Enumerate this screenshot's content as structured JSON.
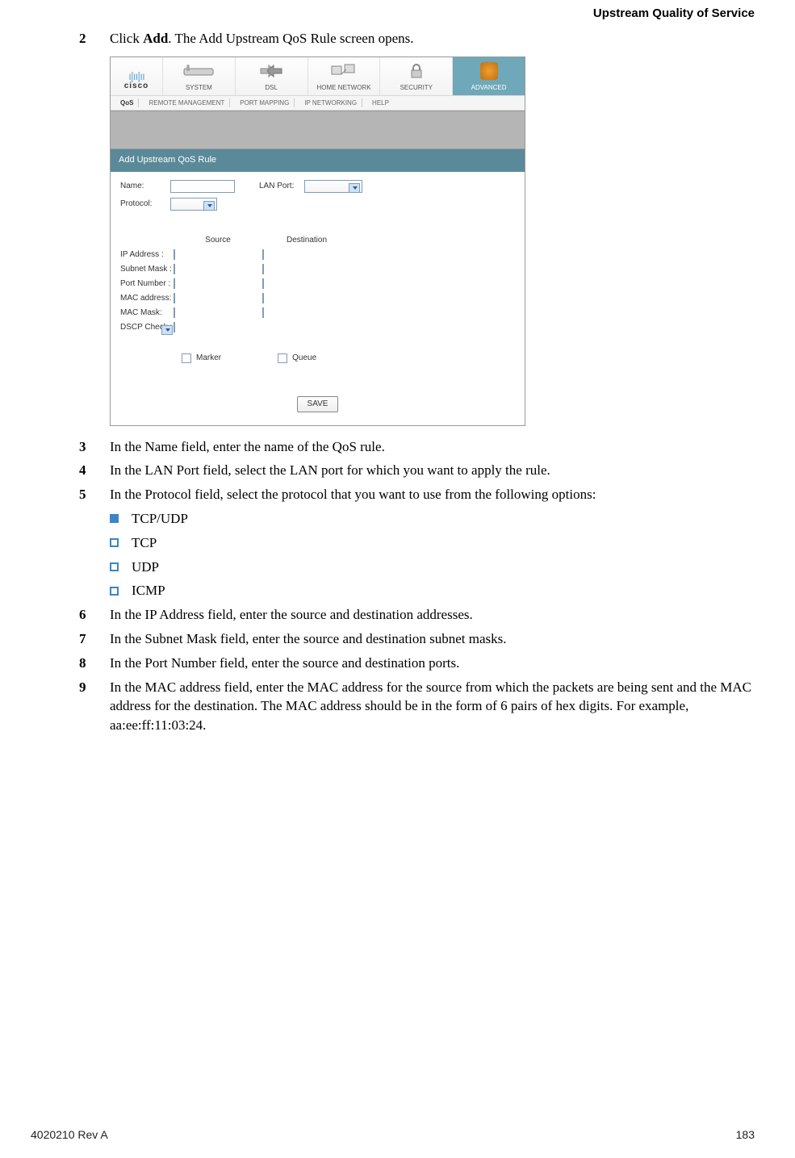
{
  "header": {
    "section_title": "Upstream Quality of Service"
  },
  "steps": {
    "s2": {
      "num": "2",
      "text_pre": "Click ",
      "bold": "Add",
      "text_post": ". The Add Upstream QoS Rule screen opens."
    },
    "s3": {
      "num": "3",
      "text": "In the Name field, enter the name of the QoS rule."
    },
    "s4": {
      "num": "4",
      "text": "In the LAN Port field, select the LAN port for which you want to apply the rule."
    },
    "s5": {
      "num": "5",
      "text": "In the Protocol field, select the protocol that you want to use from the following options:"
    },
    "s6": {
      "num": "6",
      "text": "In the IP Address field, enter the source and destination addresses."
    },
    "s7": {
      "num": "7",
      "text": "In the Subnet Mask field, enter the source and destination subnet masks."
    },
    "s8": {
      "num": "8",
      "text": "In the Port Number field, enter the source and destination ports."
    },
    "s9": {
      "num": "9",
      "text": "In the MAC address field, enter the MAC address for the source from which the packets are being sent and the MAC address for the destination. The MAC address should be in the form of 6 pairs of hex digits. For example, aa:ee:ff:11:03:24."
    }
  },
  "protocols": {
    "p1": "TCP/UDP",
    "p2": "TCP",
    "p3": "UDP",
    "p4": "ICMP"
  },
  "screenshot": {
    "brand": "cisco",
    "nav": {
      "system": "SYSTEM",
      "dsl": "DSL",
      "home_network": "HOME NETWORK",
      "security": "SECURITY",
      "advanced": "ADVANCED"
    },
    "subnav": {
      "qos": "QoS",
      "remote": "REMOTE MANAGEMENT",
      "port": "PORT MAPPING",
      "ip": "IP NETWORKING",
      "help": "HELP"
    },
    "panel_title": "Add Upstream QoS Rule",
    "labels": {
      "name": "Name:",
      "lan_port": "LAN Port:",
      "protocol": "Protocol:",
      "source": "Source",
      "destination": "Destination",
      "ip_address": "IP Address :",
      "subnet_mask": "Subnet Mask :",
      "port_number": "Port Number :",
      "mac_address": "MAC address:",
      "mac_mask": "MAC Mask:",
      "dscp_check": "DSCP Check :",
      "marker": "Marker",
      "queue": "Queue",
      "save": "SAVE"
    }
  },
  "footer": {
    "doc_id": "4020210 Rev A",
    "page_num": "183"
  }
}
